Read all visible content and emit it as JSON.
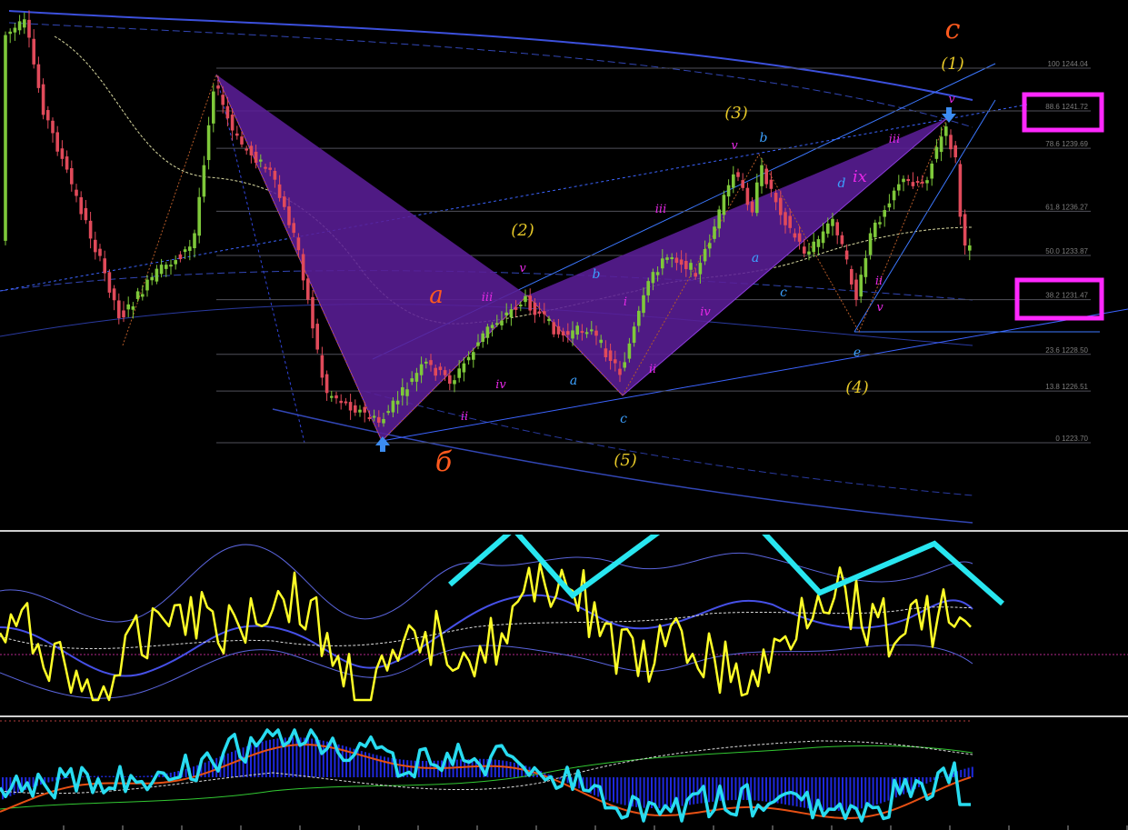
{
  "chart_data": {
    "type": "candlestick",
    "fib_levels": [
      {
        "label": "100 1244.04",
        "price": 1244.04
      },
      {
        "label": "88.6 1241.72",
        "price": 1241.72
      },
      {
        "label": "78.6 1239.69",
        "price": 1239.69
      },
      {
        "label": "61.8 1236.27",
        "price": 1236.27
      },
      {
        "label": "50.0 1233.87",
        "price": 1233.87
      },
      {
        "label": "38.2 1231.47",
        "price": 1231.47
      },
      {
        "label": "23.6 1228.50",
        "price": 1228.5
      },
      {
        "label": "13.8 1226.51",
        "price": 1226.51
      },
      {
        "label": "0 1223.70",
        "price": 1223.7
      }
    ],
    "highlighted_levels": [
      "88.6 1241.72",
      "38.2 1231.47"
    ],
    "wave_labels": {
      "orange": [
        "c",
        "a",
        "б"
      ],
      "yellow": [
        "(1)",
        "(2)",
        "(3)",
        "(4)",
        "(5)"
      ],
      "magenta": [
        "v",
        "iii",
        "i",
        "ii",
        "iv",
        "v",
        "iii",
        "iv",
        "ii",
        "v",
        "iii",
        "ix",
        "ii",
        "v"
      ],
      "cyan": [
        "b",
        "a",
        "c",
        "b",
        "a",
        "c",
        "d",
        "e"
      ]
    },
    "indicator_zigzag_pattern": "W"
  },
  "colors": {
    "background": "#000000",
    "bull_candle": "#7ec83a",
    "bear_candle": "#e04a5a",
    "pattern_fill": "#5a1e96",
    "fib_line": "#50505a",
    "highlight_box": "#ff28ff",
    "wave_orange": "#ff5a1e",
    "wave_yellow": "#e6c828",
    "wave_magenta": "#e628e6",
    "wave_cyan": "#3ca0ff",
    "oscillator": "#ffff28",
    "zigzag": "#28e6f0",
    "macd_hist": "#1e28dc",
    "channel_line": "#4664ff"
  }
}
